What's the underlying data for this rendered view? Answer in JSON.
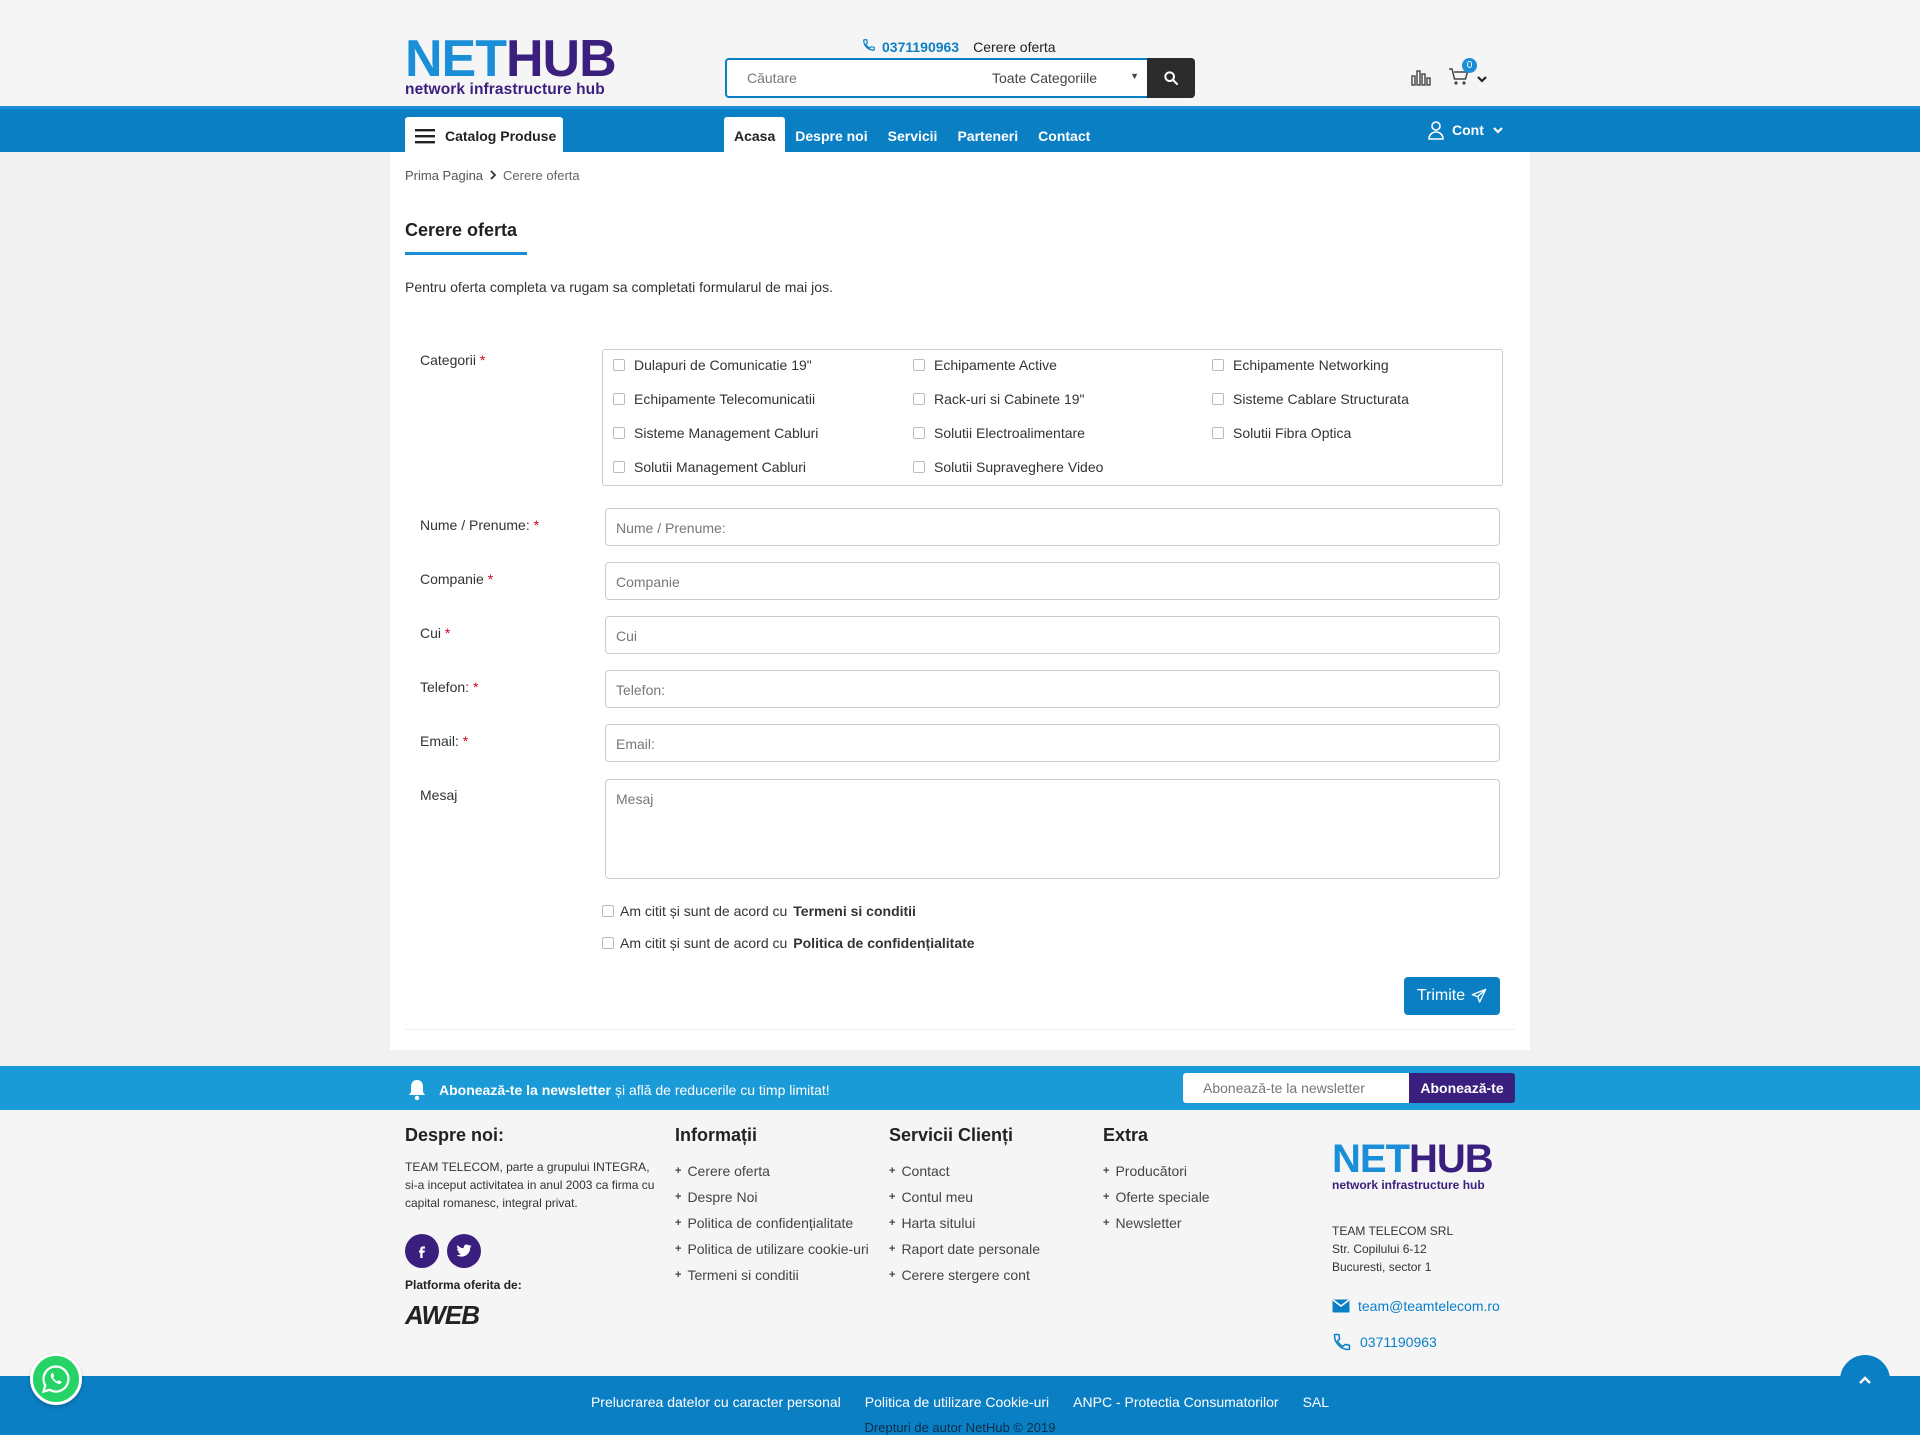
{
  "header": {
    "logo_main_1": "NET",
    "logo_main_2": "HUB",
    "logo_sub": "network infrastructure hub",
    "phone": "0371190963",
    "quote_link": "Cerere oferta",
    "search_placeholder": "Căutare",
    "search_category": "Toate Categoriile",
    "cart_count": "0"
  },
  "nav": {
    "catalog": "Catalog Produse",
    "items": [
      "Acasa",
      "Despre noi",
      "Servicii",
      "Parteneri",
      "Contact"
    ],
    "account": "Cont"
  },
  "breadcrumb": {
    "home": "Prima Pagina",
    "current": "Cerere oferta"
  },
  "page": {
    "title": "Cerere oferta",
    "intro": "Pentru oferta completa va rugam sa completati formularul de mai jos."
  },
  "form": {
    "categories_label": "Categorii",
    "categories": [
      "Dulapuri de Comunicatie 19\"",
      "Echipamente Active",
      "Echipamente Networking",
      "Echipamente Telecomunicatii",
      "Rack-uri si Cabinete 19\"",
      "Sisteme Cablare Structurata",
      "Sisteme Management Cabluri",
      "Solutii Electroalimentare",
      "Solutii Fibra Optica",
      "Solutii Management Cabluri",
      "Solutii Supraveghere Video"
    ],
    "name_label": "Nume / Prenume:",
    "name_placeholder": "Nume / Prenume:",
    "company_label": "Companie",
    "company_placeholder": "Companie",
    "cui_label": "Cui",
    "cui_placeholder": "Cui",
    "phone_label": "Telefon:",
    "phone_placeholder": "Telefon:",
    "email_label": "Email:",
    "email_placeholder": "Email:",
    "message_label": "Mesaj",
    "message_placeholder": "Mesaj",
    "agree_prefix": "Am citit și sunt de acord cu",
    "terms": "Termeni si conditii",
    "privacy": "Politica de confidențialitate",
    "submit": "Trimite",
    "required_mark": "*"
  },
  "newsletter": {
    "bold": "Abonează-te la newsletter",
    "rest": "și află de reducerile cu timp limitat!",
    "placeholder": "Abonează-te la newsletter",
    "button": "Abonează-te"
  },
  "footer": {
    "about_title": "Despre noi:",
    "about_text": "TEAM TELECOM, parte a grupului INTEGRA, si-a inceput activitatea in anul 2003 ca firma cu capital romanesc, integral privat.",
    "platform": "Platforma oferita de:",
    "aweb": "AWEB",
    "info_title": "Informații",
    "info_items": [
      "Cerere oferta",
      "Despre Noi",
      "Politica de confidențialitate",
      "Politica de utilizare cookie-uri",
      "Termeni si conditii"
    ],
    "services_title": "Servicii Clienți",
    "services_items": [
      "Contact",
      "Contul meu",
      "Harta sitului",
      "Raport date personale",
      "Cerere stergere cont"
    ],
    "extra_title": "Extra",
    "extra_items": [
      "Producători",
      "Oferte speciale",
      "Newsletter"
    ],
    "company": "TEAM TELECOM SRL",
    "street": "Str. Copilului 6-12",
    "city": "Bucuresti, sector 1",
    "email": "team@teamtelecom.ro",
    "phone": "0371190963"
  },
  "bottom": {
    "links": [
      "Prelucrarea datelor cu caracter personal",
      "Politica de utilizare Cookie-uri",
      "ANPC - Protectia Consumatorilor",
      "SAL"
    ],
    "copyright": "Drepturi de autor NetHub © 2019"
  },
  "colors": {
    "primary": "#0b7fc4",
    "accent": "#1a8fd8",
    "brand_dark": "#3b1f7e",
    "required": "#d0021b"
  }
}
